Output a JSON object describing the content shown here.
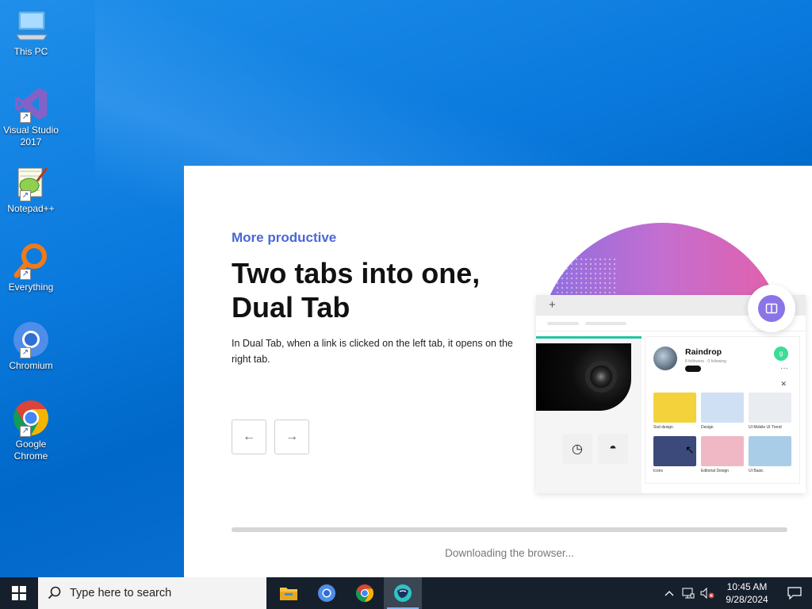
{
  "desktop": {
    "icons": [
      {
        "label": "This PC",
        "icon": "this-pc-icon"
      },
      {
        "label": "Visual Studio 2017",
        "icon": "visual-studio-icon"
      },
      {
        "label": "Notepad++",
        "icon": "notepadpp-icon"
      },
      {
        "label": "Everything",
        "icon": "everything-icon"
      },
      {
        "label": "Chromium",
        "icon": "chromium-icon"
      },
      {
        "label": "Google Chrome",
        "icon": "chrome-icon"
      }
    ]
  },
  "installer": {
    "kicker": "More productive",
    "headline": "Two tabs into one, Dual Tab",
    "description": "In Dual Tab, when a link is clicked on the left tab, it opens on the right tab.",
    "prev_glyph": "←",
    "next_glyph": "→",
    "progress_fraction": 1.0,
    "status": "Downloading the browser...",
    "illustration": {
      "tab_plus": "+",
      "profile_name": "Raindrop",
      "profile_meta": "8 followers · 0 following",
      "tile_captions": [
        "Ssd design",
        "Design",
        "UI Mobile UI Trend",
        "Icons",
        "Editorial Design",
        "UI Basic"
      ]
    },
    "accent_color": "#4a67d6"
  },
  "taskbar": {
    "search_placeholder": "Type here to search",
    "apps": [
      "file-explorer-icon",
      "chromium-icon",
      "chrome-icon",
      "whale-browser-icon"
    ],
    "clock_time": "10:45 AM",
    "clock_date": "9/28/2024"
  }
}
